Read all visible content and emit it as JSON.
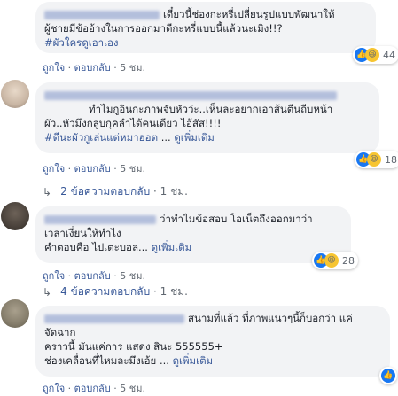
{
  "comments": [
    {
      "line1": "เดี๋ยวนี้ช่องกะหรี่เปลี่ยนรูปแบบพัฒนาให้",
      "line2": "ผู้ชายมีข้ออ้างในการออกมาตีกะหรี่แบบนี้แล้วนะเมิง!!?",
      "hashtag": "#ผัวใครดูเอาเอง",
      "like": "ถูกใจ",
      "reply": "ตอบกลับ",
      "time": "5 ชม.",
      "reactions": {
        "count": "44",
        "icons": [
          "like-icon",
          "haha-icon"
        ]
      }
    },
    {
      "line1": "ทำไมกูอินกะภาพจับหัวว่ะ..เห็นละอยากเอาส้นตีนถีบหน้า",
      "line2": "ผัว..หัวมึงกลูบกุคลำได้คนเดียว ไอ้สัส!!!!",
      "hashtag": "#ตีนะผัวกูเล่นแต่หมาฮอต",
      "seemore": "ดูเพิ่มเติม",
      "like": "ถูกใจ",
      "reply": "ตอบกลับ",
      "time": "5 ชม.",
      "reactions": {
        "count": "18",
        "icons": [
          "like-icon",
          "haha-icon"
        ]
      },
      "replies": {
        "label": "2 ข้อความตอบกลับ",
        "time": "1 ชม."
      }
    },
    {
      "line1": "ว่าทำไมข้อสอบ โอเน็ตถึงออกมาว่า",
      "line2": "เวลาเงี่ยนให้ทำไง",
      "line3": "คำตอบคือ ไปเตะบอล...",
      "seemore": "ดูเพิ่มเติม",
      "like": "ถูกใจ",
      "reply": "ตอบกลับ",
      "time": "5 ชม.",
      "reactions": {
        "count": "28",
        "icons": [
          "like-icon",
          "haha-icon"
        ]
      },
      "replies": {
        "label": "4 ข้อความตอบกลับ",
        "time": "1 ชม."
      }
    },
    {
      "line1": "สนามที่แล้ว ที่ภาพแนวๆนี้ก็บอกว่า แค่",
      "line2": "จัดฉาก",
      "line3": "คราวนี้ มันแค่การ แสดง สินะ 555555+",
      "line4": "ช่องเคลื่อนที่ไหมละมึงเอ้ย ...",
      "seemore": "ดูเพิ่มเติม",
      "like": "ถูกใจ",
      "reply": "ตอบกลับ",
      "time": "5 ชม.",
      "reactions": {
        "count": "",
        "icons": [
          "like-icon"
        ]
      }
    }
  ],
  "colors": {
    "link": "#385898",
    "bubble": "#f2f3f5",
    "like": "#1877f2",
    "haha": "#f7c531"
  }
}
